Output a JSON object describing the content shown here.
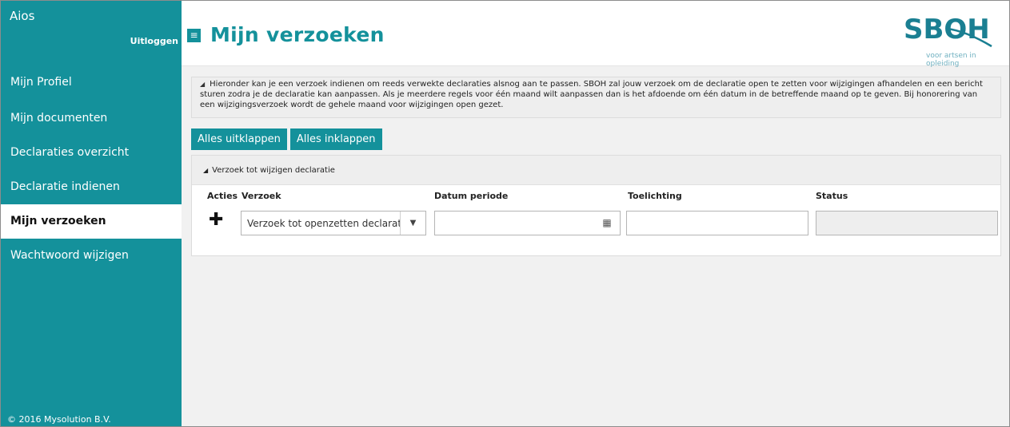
{
  "sidebar": {
    "app_title": "Aios",
    "logout_label": "Uitloggen",
    "items": [
      {
        "label": "Mijn Profiel"
      },
      {
        "label": "Mijn documenten"
      },
      {
        "label": "Declaraties overzicht"
      },
      {
        "label": "Declaratie indienen"
      },
      {
        "label": "Mijn verzoeken",
        "active": true
      },
      {
        "label": "Wachtwoord wijzigen"
      }
    ],
    "copyright": "© 2016 Mysolution B.V."
  },
  "header": {
    "menu_icon": "hamburger-icon",
    "title": "Mijn verzoeken",
    "logo_text": "SBOH",
    "logo_tagline": "voor artsen in opleiding"
  },
  "info": {
    "text": "Hieronder kan je een verzoek indienen om reeds verwekte declaraties alsnog aan te passen. SBOH zal jouw verzoek om de declaratie open te zetten voor wijzigingen afhandelen en een bericht sturen zodra je de declaratie kan aanpassen. Als je meerdere regels voor één maand wilt aanpassen dan is het afdoende om één datum in de betreffende maand op te geven. Bij honorering van een wijzigingsverzoek wordt de gehele maand voor wijzigingen open gezet."
  },
  "buttons": {
    "expand_all": "Alles uitklappen",
    "collapse_all": "Alles inklappen"
  },
  "panel": {
    "title": "Verzoek tot wijzigen declaratie",
    "columns": {
      "actions": "Acties",
      "request": "Verzoek",
      "date": "Datum periode",
      "note": "Toelichting",
      "status": "Status"
    },
    "row": {
      "add_icon": "plus-icon",
      "request_value": "Verzoek tot openzetten declaratie",
      "date_value": "",
      "note_value": "",
      "status_value": ""
    }
  },
  "colors": {
    "accent": "#14919b",
    "background": "#f1f1f1"
  }
}
